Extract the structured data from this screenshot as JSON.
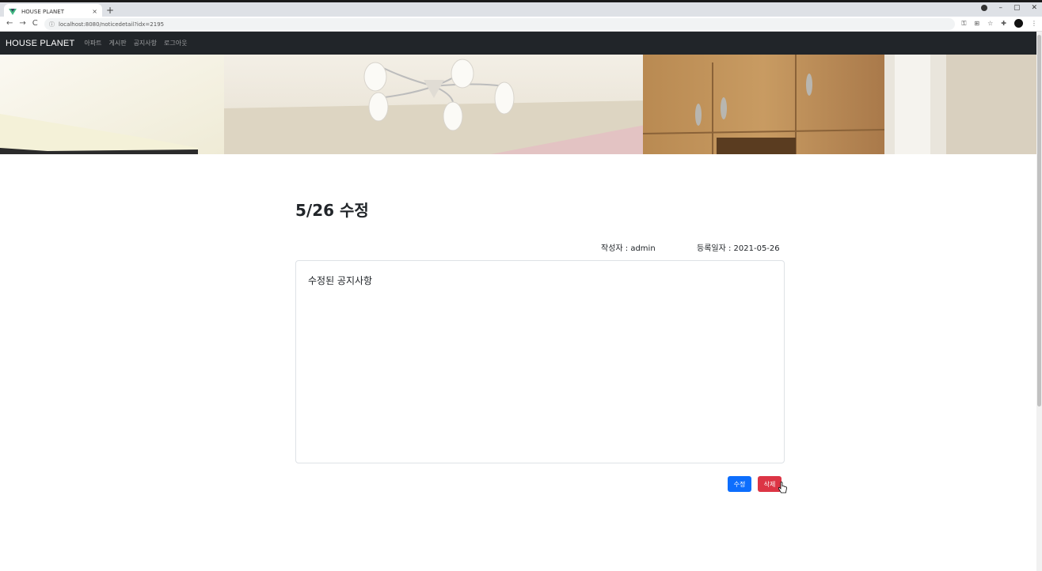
{
  "browser": {
    "tab_title": "HOUSE PLANET",
    "tab_close": "×",
    "new_tab": "+",
    "url": "localhost:8080/noticedetail?idx=2195",
    "nav_back": "←",
    "nav_forward": "→",
    "nav_reload": "C",
    "win_min": "–",
    "win_max": "▢",
    "win_close": "✕"
  },
  "navbar": {
    "brand": "HOUSE PLANET",
    "links": [
      "아파트",
      "게시판",
      "공지사항",
      "로그아웃"
    ]
  },
  "notice": {
    "title": "5/26 수정",
    "author_label": "작성자 : admin",
    "date_label": "등록일자 : 2021-05-26",
    "content": "수정된 공지사항"
  },
  "buttons": {
    "edit": "수정",
    "delete": "삭제"
  },
  "colors": {
    "navbar_bg": "#212529",
    "edit_btn": "#0d6efd",
    "delete_btn": "#dc3545"
  }
}
